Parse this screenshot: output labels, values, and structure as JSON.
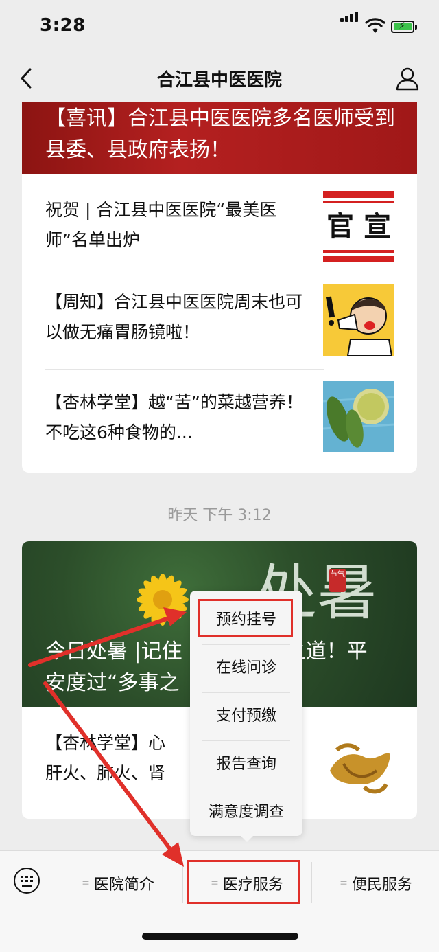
{
  "status_bar": {
    "time": "3:28"
  },
  "nav": {
    "title": "合江县中医医院"
  },
  "feed": {
    "group1": {
      "headline": "【喜讯】合江县中医医院多名医师受到县委、县政府表扬！",
      "items": [
        {
          "title": "祝贺 | 合江县中医医院“最美医师”名单出炉",
          "thumb_text": "官 宣"
        },
        {
          "title": "【周知】合江县中医医院周末也可以做无痛胃肠镜啦！"
        },
        {
          "title": "【杏林学堂】越“苦”的菜越营养！不吃这6种食物的..."
        }
      ]
    },
    "timestamp": "昨天 下午 3:12",
    "group2": {
      "headline": "今日处暑 | 记住这几个养生之道！平安度过“多事之秋”",
      "headline_visible": "今日处暑 |记住",
      "headline_right": "之道！平",
      "headline_line2": "安度过“多事之",
      "calligraphy": "处暑",
      "seal": "节气",
      "items": [
        {
          "title_line1": "【杏林学堂】心",
          "title_line2": "肝火、肺火、肾"
        }
      ]
    }
  },
  "popup_menu": {
    "items": [
      "预约挂号",
      "在线问诊",
      "支付预缴",
      "报告查询",
      "满意度调查"
    ]
  },
  "bottom_menu": {
    "items": [
      {
        "label": "医院简介",
        "icon": "list-icon"
      },
      {
        "label": "医疗服务",
        "icon": "list-icon"
      },
      {
        "label": "便民服务",
        "icon": "list-icon"
      }
    ]
  },
  "colors": {
    "highlight": "#e0302a",
    "accent_green": "#3bc24a"
  }
}
